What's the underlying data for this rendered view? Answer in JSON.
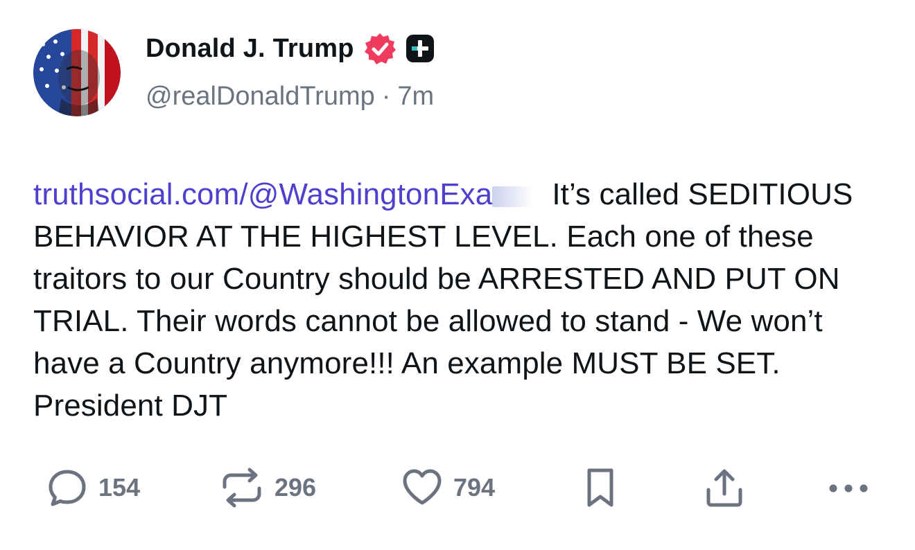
{
  "author": {
    "display_name": "Donald J. Trump",
    "handle": "@realDonaldTrump",
    "separator": "·",
    "time_ago": "7m",
    "avatar_icon": "american-flag-portrait-avatar",
    "verified_icon": "verified-badge-icon",
    "verified_color": "#ef3b5e",
    "plus_icon": "truth-plus-icon"
  },
  "post": {
    "link_text": "truthsocial.com/@WashingtonExa",
    "link_color": "#4f3fce",
    "body": "It’s called SEDITIOUS BEHAVIOR AT THE HIGHEST LEVEL. Each one of these traitors to our Country should be ARRESTED AND PUT ON TRIAL. Their words cannot be allowed to stand - We won’t have a Country anymore!!! An example MUST BE SET. President DJT"
  },
  "actions": {
    "reply": {
      "icon": "comment-icon",
      "count": "154"
    },
    "retruth": {
      "icon": "repost-icon",
      "count": "296"
    },
    "like": {
      "icon": "heart-icon",
      "count": "794"
    },
    "bookmark": {
      "icon": "bookmark-icon"
    },
    "share": {
      "icon": "share-icon"
    },
    "more": {
      "icon": "more-icon"
    }
  }
}
